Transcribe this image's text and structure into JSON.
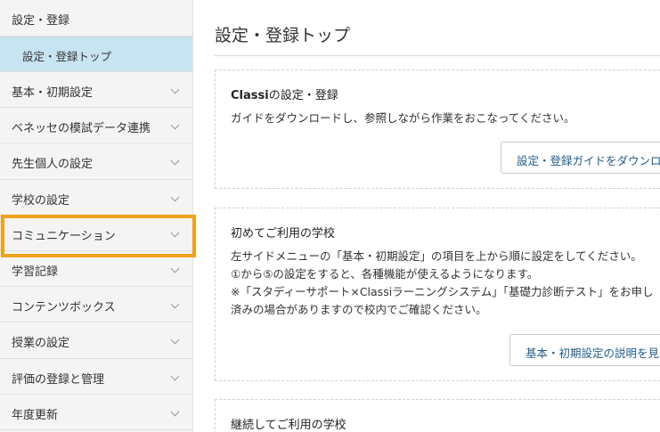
{
  "sidebar": {
    "header": "設定・登録",
    "active_sub": "設定・登録トップ",
    "items": [
      {
        "label": "基本・初期設定"
      },
      {
        "label": "ベネッセの模試データ連携"
      },
      {
        "label": "先生個人の設定"
      },
      {
        "label": "学校の設定"
      },
      {
        "label": "コミュニケーション"
      },
      {
        "label": "学習記録"
      },
      {
        "label": "コンテンツボックス"
      },
      {
        "label": "授業の設定"
      },
      {
        "label": "評価の登録と管理"
      },
      {
        "label": "年度更新"
      }
    ]
  },
  "main": {
    "title": "設定・登録トップ",
    "cards": [
      {
        "title_bold": "Classi",
        "title_rest": "の設定・登録",
        "lines": [
          "ガイドをダウンロードし、参照しながら作業をおこなってください。"
        ],
        "button": "設定・登録ガイドをダウンロ"
      },
      {
        "title": "初めてご利用の学校",
        "lines": [
          "左サイドメニューの「基本・初期設定」の項目を上から順に設定をしてください。",
          "①から⑤の設定をすると、各種機能が使えるようになります。",
          "※「スタディーサポート×Classiラーニングシステム」「基礎力診断テスト」をお申し",
          "済みの場合がありますので校内でご確認ください。"
        ],
        "button": "基本・初期設定の説明を見"
      },
      {
        "title": "継続してご利用の学校"
      }
    ]
  },
  "colors": {
    "highlight": "#f0a11d",
    "active_bg": "#c7e4f1",
    "link": "#1f5c8a"
  }
}
